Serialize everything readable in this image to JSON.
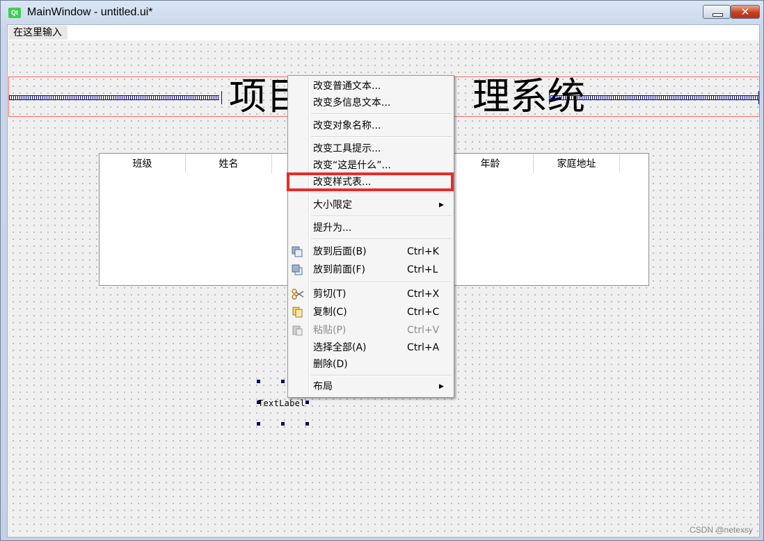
{
  "window": {
    "title": "MainWindow - untitled.ui*",
    "logo_text": "Qt",
    "minimize_icon": "minimize-icon",
    "close_label": "✕"
  },
  "menubar": {
    "placeholder": "在这里输入"
  },
  "form": {
    "heading_left": "项目",
    "heading_right": "理系统",
    "spring_color": "#0a0a8c",
    "layout_border_color": "#ff6a6a"
  },
  "table": {
    "headers": [
      "班级",
      "姓名",
      "",
      "",
      "年龄",
      "家庭地址"
    ]
  },
  "label_widget": {
    "text": "TextLabel"
  },
  "context_menu": {
    "items": [
      {
        "label": "改变普通文本..."
      },
      {
        "label": "改变多信息文本..."
      },
      {
        "label": "改变对象名称..."
      },
      {
        "label": "改变工具提示..."
      },
      {
        "label": "改变“这是什么”..."
      },
      {
        "label": "改变样式表..."
      },
      {
        "label": "大小限定",
        "submenu": "▶"
      },
      {
        "label": "提升为..."
      },
      {
        "label": "放到后面(B)",
        "shortcut": "Ctrl+K",
        "icon": "send-to-back-icon"
      },
      {
        "label": "放到前面(F)",
        "shortcut": "Ctrl+L",
        "icon": "bring-to-front-icon"
      },
      {
        "label": "剪切(T)",
        "shortcut": "Ctrl+X",
        "icon": "scissors-icon"
      },
      {
        "label": "复制(C)",
        "shortcut": "Ctrl+C",
        "icon": "copy-icon"
      },
      {
        "label": "粘贴(P)",
        "shortcut": "Ctrl+V",
        "icon": "paste-icon",
        "disabled": true
      },
      {
        "label": "选择全部(A)",
        "shortcut": "Ctrl+A"
      },
      {
        "label": "删除(D)"
      },
      {
        "label": "布局",
        "submenu": "▶"
      }
    ],
    "highlight_color": "#ea2a2a"
  },
  "watermark": "CSDN @netexsy"
}
